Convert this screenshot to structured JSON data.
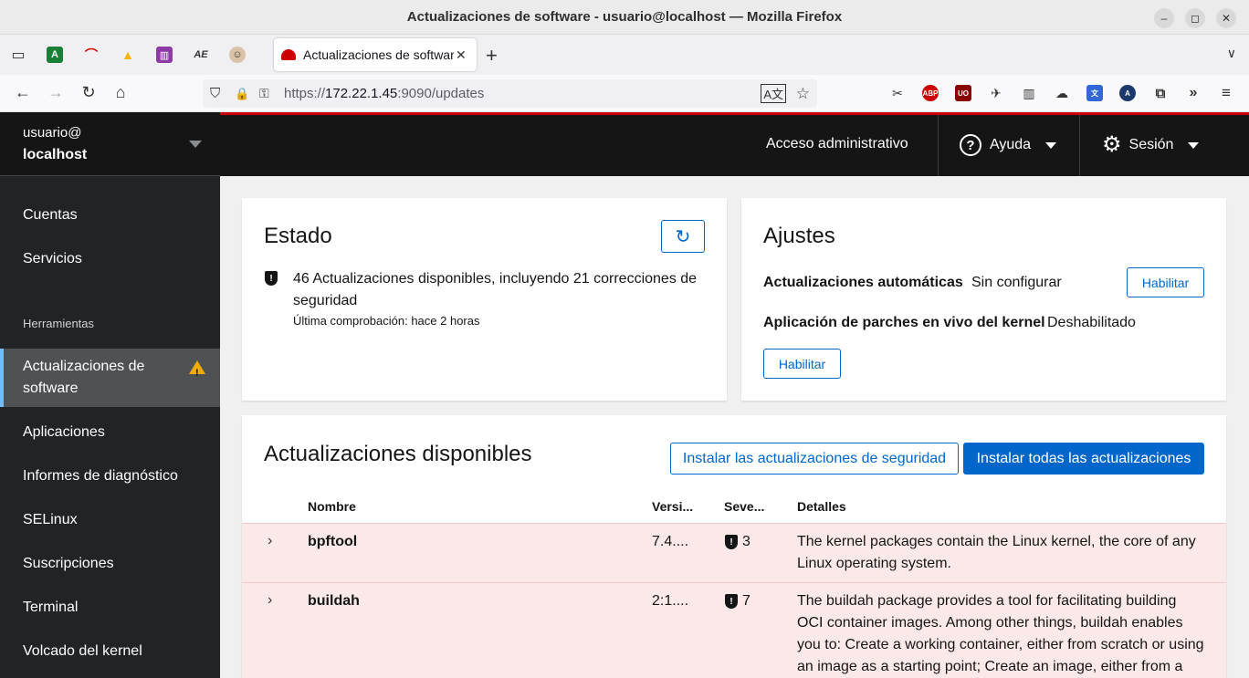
{
  "window": {
    "title": "Actualizaciones de software - usuario@localhost — Mozilla Firefox"
  },
  "browser": {
    "active_tab_title": "Actualizaciones de software",
    "url_prefix": "https://",
    "url_host": "172.22.1.45",
    "url_rest": ":9090/updates"
  },
  "host": {
    "user": "usuario@",
    "name": "localhost"
  },
  "topbar": {
    "admin_label": "Acceso administrativo",
    "help_label": "Ayuda",
    "session_label": "Sesión"
  },
  "sidebar": {
    "items_top": [
      "Cuentas",
      "Servicios"
    ],
    "section_label": "Herramientas",
    "active_item": "Actualizaciones de software",
    "items_tools": [
      "Aplicaciones",
      "Informes de diagnóstico",
      "SELinux",
      "Suscripciones",
      "Terminal",
      "Volcado del kernel"
    ]
  },
  "status_card": {
    "title": "Estado",
    "summary": "46 Actualizaciones disponibles, incluyendo 21 correcciones de seguridad",
    "last_check": "Última comprobación: hace 2 horas"
  },
  "settings_card": {
    "title": "Ajustes",
    "auto_updates_label": "Actualizaciones automáticas",
    "auto_updates_value": "Sin configurar",
    "enable_label": "Habilitar",
    "kpatch_label": "Aplicación de parches en vivo del kernel",
    "kpatch_value": "Deshabilitado",
    "enable2_label": "Habilitar"
  },
  "updates": {
    "title": "Actualizaciones disponibles",
    "install_security_label": "Instalar las actualizaciones de seguridad",
    "install_all_label": "Instalar todas las actualizaciones",
    "columns": [
      "Nombre",
      "Versi...",
      "Seve...",
      "Detalles"
    ],
    "rows": [
      {
        "name": "bpftool",
        "version": "7.4....",
        "severity": "3",
        "details_lines": [
          "The kernel packages contain the Linux kernel, the core of any",
          "Linux operating system."
        ]
      },
      {
        "name": "buildah",
        "version": "2:1....",
        "severity": "7",
        "details_lines": [
          "The buildah package provides a tool for facilitating building",
          "OCI container images. Among other things, buildah enables",
          "you to: Create a working container, either from scratch or using",
          "an image as a starting point; Create an image, either from a"
        ]
      }
    ]
  },
  "colors": {
    "accent": "#0066cc",
    "danger_row": "#fbe9e9",
    "warning": "#f0ab00"
  }
}
